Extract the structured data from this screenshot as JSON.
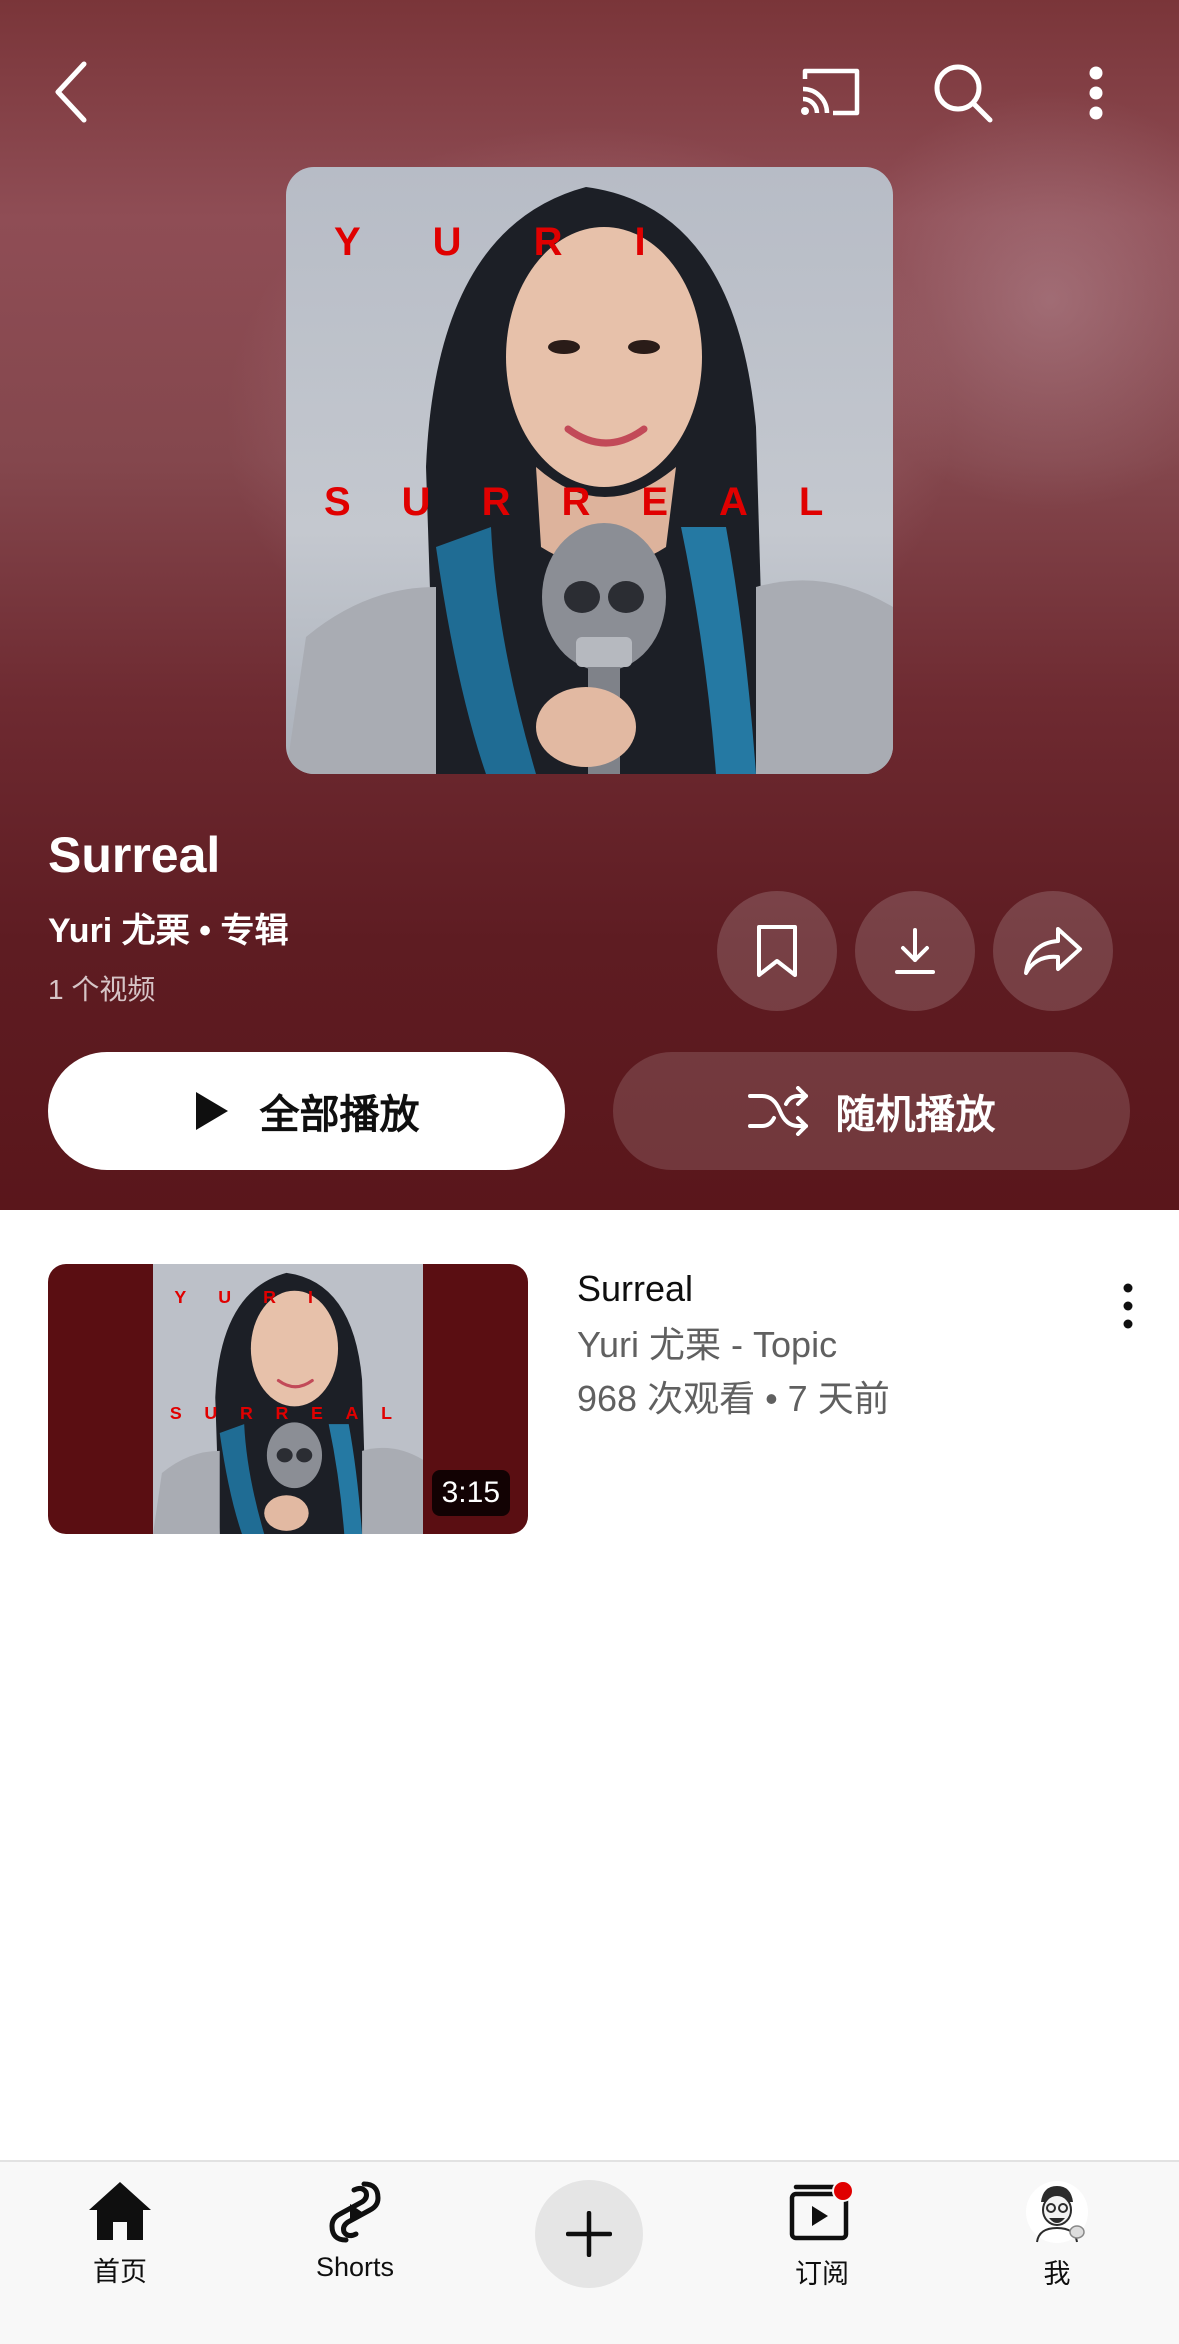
{
  "header": {
    "back_icon": "back-arrow-icon",
    "cast_icon": "cast-icon",
    "search_icon": "search-icon",
    "more_icon": "more-vert-icon"
  },
  "album": {
    "cover_text_top": "Y U R I",
    "cover_text_bottom": "S U R R E A L",
    "title": "Surreal",
    "subtitle": "Yuri 尤栗 • 专辑",
    "video_count": "1 个视频"
  },
  "actions": {
    "save_icon": "bookmark-icon",
    "download_icon": "download-icon",
    "share_icon": "share-icon",
    "play_all_label": "全部播放",
    "shuffle_label": "随机播放"
  },
  "videos": [
    {
      "title": "Surreal",
      "channel": "Yuri 尤栗 - Topic",
      "meta": "968 次观看 • 7 天前",
      "duration": "3:15"
    }
  ],
  "bottom_nav": {
    "home_label": "首页",
    "shorts_label": "Shorts",
    "subscriptions_label": "订阅",
    "you_label": "我"
  },
  "colors": {
    "hero_top": "#7a3539",
    "hero_bottom": "#5a161b",
    "accent_red": "#e00000",
    "thumb_bg": "#5a0e12"
  }
}
